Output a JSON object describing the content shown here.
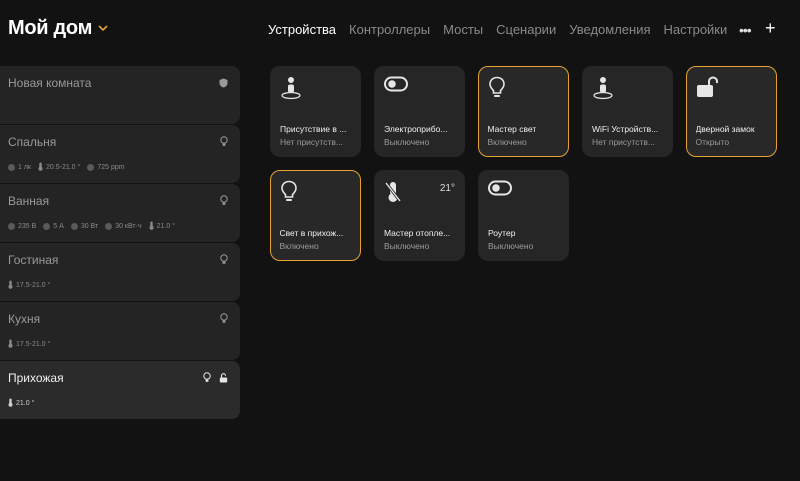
{
  "header": {
    "title": "Мой дом",
    "tabs": [
      "Устройства",
      "Контроллеры",
      "Мосты",
      "Сценарии",
      "Уведомления",
      "Настройки"
    ],
    "more_label": "•••",
    "add_label": "+"
  },
  "rooms": [
    {
      "name": "Новая комната",
      "metrics": []
    },
    {
      "name": "Спальня",
      "metrics": [
        "1 лк",
        "20.5-21.0 °",
        "725 ppm"
      ]
    },
    {
      "name": "Ванная",
      "metrics": [
        "235 В",
        "5 А",
        "30 Вт",
        "30 кВт·ч",
        "21.0 °"
      ]
    },
    {
      "name": "Гостиная",
      "metrics": [
        "17.5-21.0 °"
      ]
    },
    {
      "name": "Кухня",
      "metrics": [
        "17.5-21.0 °"
      ]
    },
    {
      "name": "Прихожая",
      "metrics": [
        "21.0 °"
      ]
    }
  ],
  "devices": [
    {
      "name": "Присутствие в ...",
      "state": "Нет присутств...",
      "temp": ""
    },
    {
      "name": "Электроприбо...",
      "state": "Выключено",
      "temp": ""
    },
    {
      "name": "Мастер свет",
      "state": "Включено",
      "temp": ""
    },
    {
      "name": "WiFi Устройств...",
      "state": "Нет присутств...",
      "temp": ""
    },
    {
      "name": "Дверной замок",
      "state": "Открыто",
      "temp": ""
    },
    {
      "name": "Свет в прихож...",
      "state": "Включено",
      "temp": ""
    },
    {
      "name": "Мастер отопле...",
      "state": "Выключено",
      "temp": "21°"
    },
    {
      "name": "Роутер",
      "state": "Выключено",
      "temp": ""
    }
  ],
  "colors": {
    "accent": "#e3a233",
    "background": "#121212",
    "card": "#262626"
  }
}
